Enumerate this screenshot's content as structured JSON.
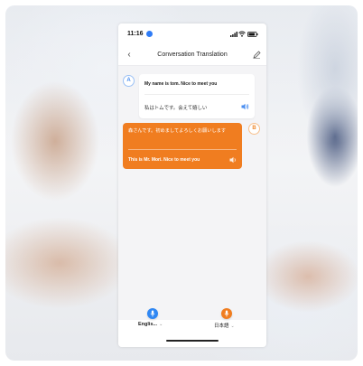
{
  "status_bar": {
    "time": "11:16"
  },
  "nav": {
    "title": "Conversation Translation"
  },
  "messages": [
    {
      "speaker": "A",
      "original": "My name is tom. Nice to meet you",
      "translation": "私はトムです。会えて嬉しい"
    },
    {
      "speaker": "B",
      "original": "森さんです。初めましてよろしくお願いします",
      "translation": "This is Mr. Mori. Nice to meet you"
    }
  ],
  "languages": {
    "left": "Englis...",
    "right": "日本語"
  },
  "colors": {
    "accent_blue": "#2f87f3",
    "accent_orange": "#f07d20"
  }
}
